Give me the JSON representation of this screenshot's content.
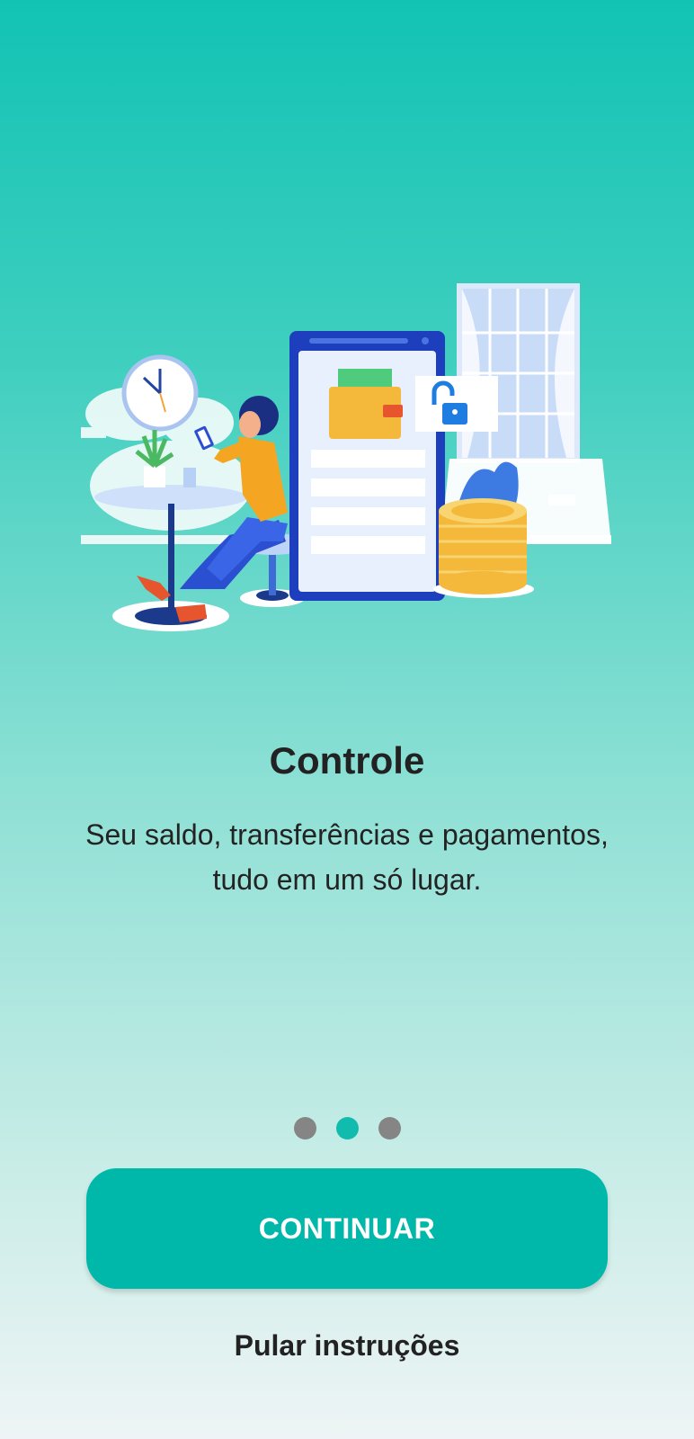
{
  "onboarding": {
    "title": "Controle",
    "subtitle": "Seu saldo, transferências e pagamentos, tudo em um só lugar.",
    "page_indicator": {
      "total": 3,
      "current": 2
    },
    "continue_label": "CONTINUAR",
    "skip_label": "Pular instruções"
  },
  "colors": {
    "accent": "#00b8a9",
    "dot_inactive": "#858585",
    "dot_active": "#11bcae"
  },
  "illustration": {
    "icons": [
      "clock-icon",
      "plant-icon",
      "woman-icon",
      "phone-icon",
      "wallet-icon",
      "unlock-icon",
      "coins-icon",
      "window-icon"
    ]
  }
}
